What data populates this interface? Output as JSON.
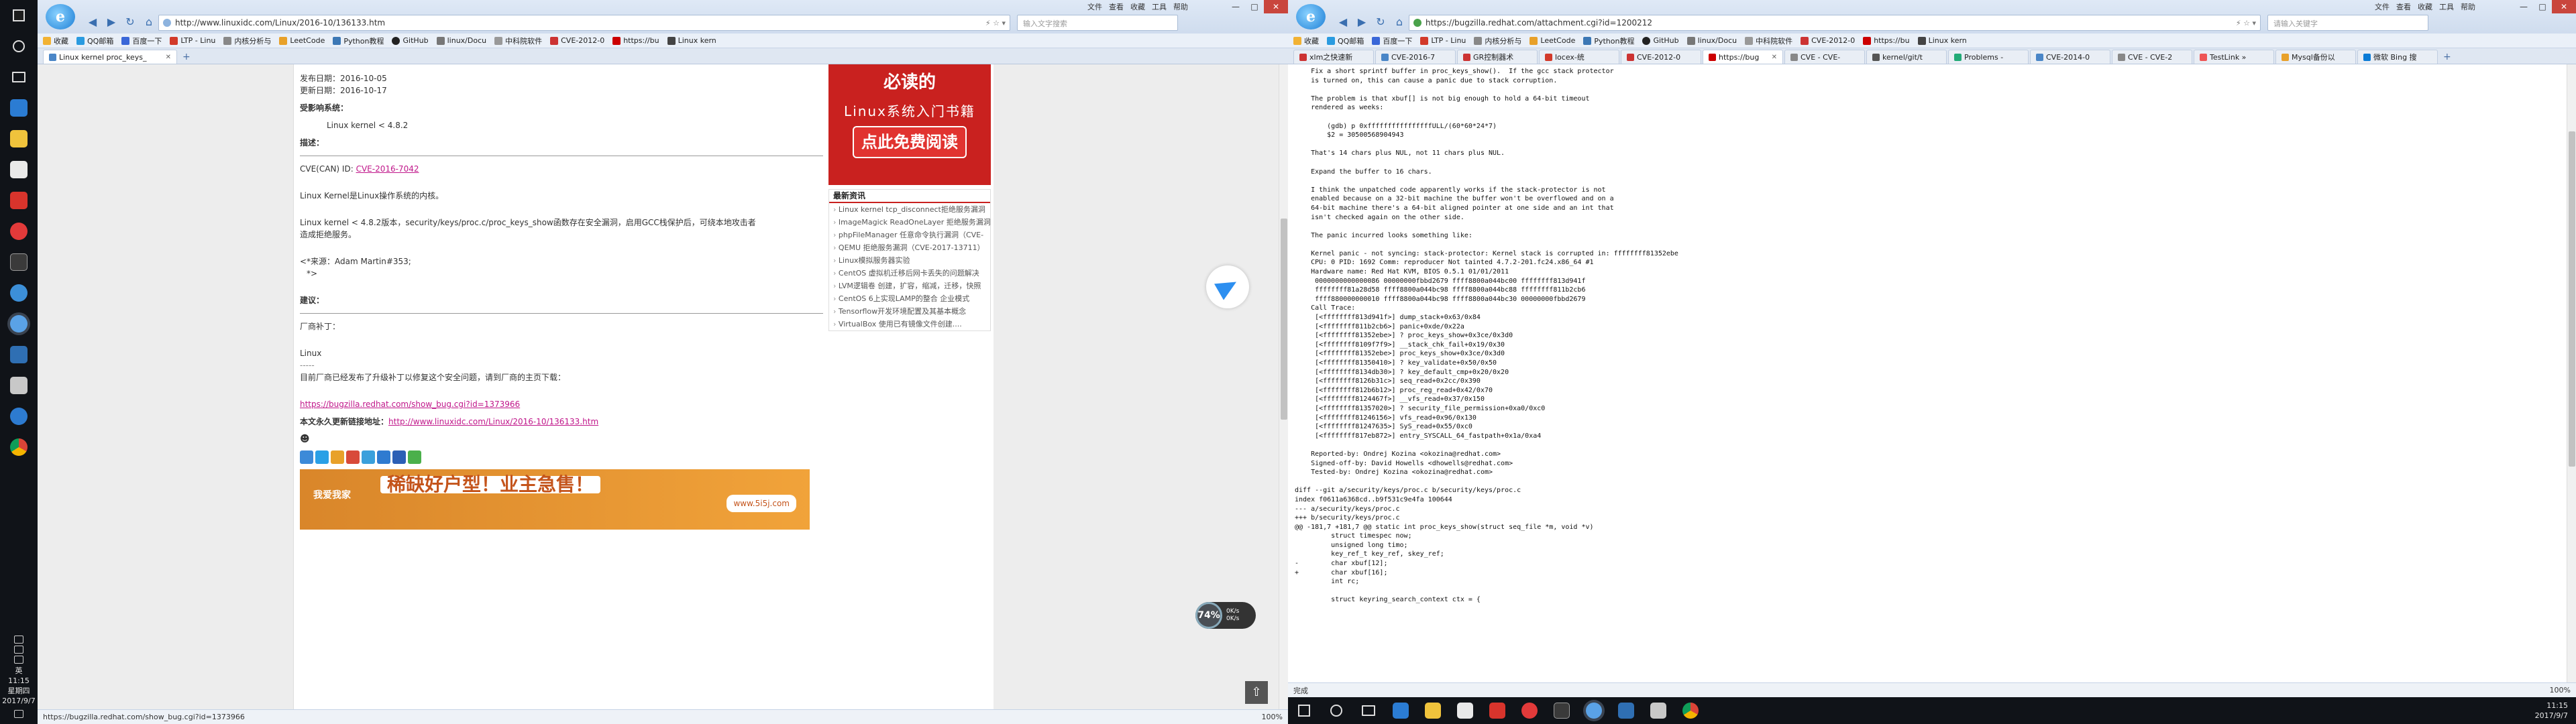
{
  "left_browser": {
    "url": "http://www.linuxidc.com/Linux/2016-10/136133.htm",
    "search_placeholder": "输入文字搜索",
    "menu": [
      "文件",
      "查看",
      "收藏",
      "工具",
      "帮助"
    ],
    "bookmarks": [
      "收藏",
      "QQ邮箱",
      "百度一下",
      "LTP - Linu",
      "内核分析与",
      "LeetCode",
      "Python教程",
      "GitHub",
      "linux/Docu",
      "中科院软件",
      "CVE-2012-0",
      "https://bu",
      "Linux kern"
    ],
    "tab": "Linux kernel proc_keys_",
    "status_url": "https://bugzilla.redhat.com/show_bug.cgi?id=1373966",
    "status_zoom": "100%"
  },
  "article": {
    "published": "发布日期：2016-10-05",
    "updated": "更新日期：2016-10-17",
    "affected_label": "受影响系统：",
    "affected_value": "Linux kernel < 4.8.2",
    "desc_label": "描述：",
    "cve_prefix": "CVE(CAN) ID: ",
    "cve_link": "CVE-2016-7042",
    "p1": "Linux Kernel是Linux操作系统的内核。",
    "p2a": "Linux kernel < 4.8.2版本，security/keys/proc.c/proc_keys_show函数存在安全漏洞，启用GCC栈保护后，可绕本地攻击者",
    "p2b": "造成拒绝服务。",
    "source1": "<*来源：Adam Martin#353;",
    "source2": "*>",
    "suggest_label": "建议：",
    "vendor_patch": "厂商补丁：",
    "linux": "Linux",
    "dashes": "-----",
    "p3": "目前厂商已经发布了升级补丁以修复这个安全问题，请到厂商的主页下载：",
    "patch_link": "https://bugzilla.redhat.com/show_bug.cgi?id=1373966",
    "permalink_label": "本文永久更新链接地址：",
    "permalink": "http://www.linuxidc.com/Linux/2016-10/136133.htm",
    "ad_brand": "我爱我家",
    "ad_text": "稀缺好户型！业主急售！",
    "ad_site": "www.5i5j.com"
  },
  "sidebar": {
    "ad_line1": "必读的",
    "ad_line2": "Linux系统入门书籍",
    "ad_button": "点此免费阅读",
    "news_title": "最新资讯",
    "news": [
      "Linux kernel tcp_disconnect拒绝服务漏洞",
      "ImageMagick ReadOneLayer 拒绝服务漏洞（",
      "phpFileManager 任意命令执行漏洞（CVE-",
      "QEMU 拒绝服务漏洞（CVE-2017-13711）",
      "Linux模拟服务器实验",
      "CentOS 虚拟机迁移后网卡丢失的问题解决",
      "LVM逻辑卷 创建，扩容，缩减，迁移，快照",
      "CentOS 6上实现LAMP的整合 企业模式",
      "Tensorflow开发环境配置及其基本概念",
      "VirtualBox 使用已有镜像文件创建...."
    ]
  },
  "widgets": {
    "speed_pct": "74%",
    "speed_up": "0K/s",
    "speed_down": "0K/s"
  },
  "right_browser": {
    "url": "https://bugzilla.redhat.com/attachment.cgi?id=1200212",
    "search_placeholder": "请输入关键字",
    "menu": [
      "文件",
      "查看",
      "收藏",
      "工具",
      "帮助"
    ],
    "bookmarks": [
      "收藏",
      "QQ邮箱",
      "百度一下",
      "LTP - Linu",
      "内核分析与",
      "LeetCode",
      "Python教程",
      "GitHub",
      "linux/Docu",
      "中科院软件",
      "CVE-2012-0",
      "https://bu",
      "Linux kern"
    ],
    "tabs": [
      "xlm之快速新",
      "CVE-2016-7",
      "GR控制器术",
      "locex-统",
      "CVE-2012-0",
      "https://bug",
      "CVE - CVE-",
      "kernel/git/t",
      "Problems - ",
      "CVE-2014-0",
      "CVE - CVE-2",
      "TestLink »",
      "Mysql备份以",
      "微软 Bing 搜"
    ],
    "status_left": "完成",
    "status_zoom": "100%"
  },
  "patch_lines": [
    "    Fix a short sprintf buffer in proc_keys_show().  If the gcc stack protector",
    "    is turned on, this can cause a panic due to stack corruption.",
    "",
    "    The problem is that xbuf[] is not big enough to hold a 64-bit timeout",
    "    rendered as weeks:",
    "",
    "        (gdb) p 0xffffffffffffffffULL/(60*60*24*7)",
    "        $2 = 30500568904943",
    "",
    "    That's 14 chars plus NUL, not 11 chars plus NUL.",
    "",
    "    Expand the buffer to 16 chars.",
    "",
    "    I think the unpatched code apparently works if the stack-protector is not",
    "    enabled because on a 32-bit machine the buffer won't be overflowed and on a",
    "    64-bit machine there's a 64-bit aligned pointer at one side and an int that",
    "    isn't checked again on the other side.",
    "",
    "    The panic incurred looks something like:",
    "",
    "    Kernel panic - not syncing: stack-protector: Kernel stack is corrupted in: ffffffff81352ebe",
    "    CPU: 0 PID: 1692 Comm: reproducer Not tainted 4.7.2-201.fc24.x86_64 #1",
    "    Hardware name: Red Hat KVM, BIOS 0.5.1 01/01/2011",
    "     0000000000000086 00000000fbbd2679 ffff8800a044bc00 ffffffff813d941f",
    "     ffffffff81a28d58 ffff8800a044bc98 ffff8800a044bc88 ffffffff811b2cb6",
    "     ffff880000000010 ffff8800a044bc98 ffff8800a044bc30 00000000fbbd2679",
    "    Call Trace:",
    "     [<ffffffff813d941f>] dump_stack+0x63/0x84",
    "     [<ffffffff811b2cb6>] panic+0xde/0x22a",
    "     [<ffffffff81352ebe>] ? proc_keys_show+0x3ce/0x3d0",
    "     [<ffffffff8109f7f9>] __stack_chk_fail+0x19/0x30",
    "     [<ffffffff81352ebe>] proc_keys_show+0x3ce/0x3d0",
    "     [<ffffffff81350410>] ? key_validate+0x50/0x50",
    "     [<ffffffff8134db30>] ? key_default_cmp+0x20/0x20",
    "     [<ffffffff8126b31c>] seq_read+0x2cc/0x390",
    "     [<ffffffff812b6b12>] proc_reg_read+0x42/0x70",
    "     [<ffffffff8124467f>] __vfs_read+0x37/0x150",
    "     [<ffffffff81357020>] ? security_file_permission+0xa0/0xc0",
    "     [<ffffffff81246156>] vfs_read+0x96/0x130",
    "     [<ffffffff81247635>] SyS_read+0x55/0xc0",
    "     [<ffffffff817eb872>] entry_SYSCALL_64_fastpath+0x1a/0xa4",
    "",
    "    Reported-by: Ondrej Kozina <okozina@redhat.com>",
    "    Signed-off-by: David Howells <dhowells@redhat.com>",
    "    Tested-by: Ondrej Kozina <okozina@redhat.com>",
    "",
    "diff --git a/security/keys/proc.c b/security/keys/proc.c",
    "index f0611a6368cd..b9f531c9e4fa 100644",
    "--- a/security/keys/proc.c",
    "+++ b/security/keys/proc.c",
    "@@ -181,7 +181,7 @@ static int proc_keys_show(struct seq_file *m, void *v)",
    "         struct timespec now;",
    "         unsigned long timo;",
    "         key_ref_t key_ref, skey_ref;",
    "-        char xbuf[12];",
    "+        char xbuf[16];",
    "         int rc;",
    "",
    "         struct keyring_search_context ctx = {"
  ],
  "taskbar": {
    "left_clock_time": "11:15",
    "left_clock_day": "星期四",
    "left_clock_date": "2017/9/7",
    "right_clock_time": "11:15",
    "right_clock_date": "2017/9/7",
    "lang": "英"
  },
  "colors": {
    "accent_red": "#c9211f",
    "link_magenta": "#c0168a",
    "titlebar_blue": "#dfe9f6"
  }
}
